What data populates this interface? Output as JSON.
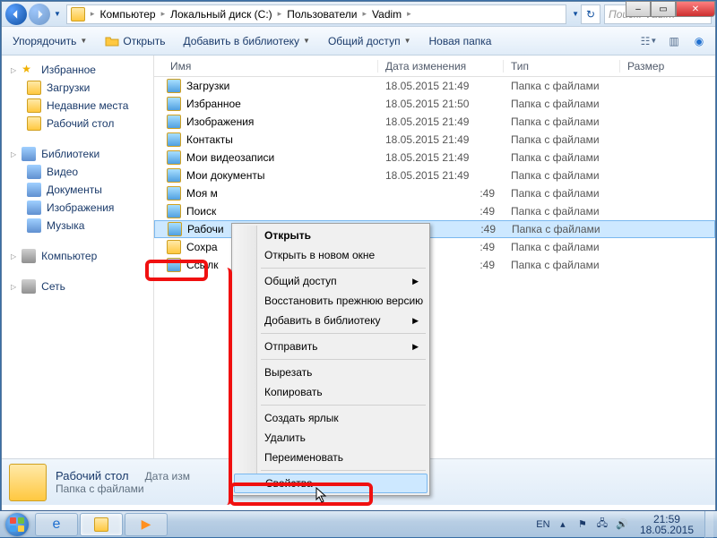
{
  "breadcrumb": {
    "p1": "Компьютер",
    "p2": "Локальный диск (C:)",
    "p3": "Пользователи",
    "p4": "Vadim"
  },
  "search_placeholder": "Поиск: Vadim",
  "toolbar": {
    "organize": "Упорядочить",
    "open": "Открыть",
    "addlib": "Добавить в библиотеку",
    "share": "Общий доступ",
    "newfolder": "Новая папка"
  },
  "columns": {
    "name": "Имя",
    "date": "Дата изменения",
    "type": "Тип",
    "size": "Размер"
  },
  "nav": {
    "favorites": "Избранное",
    "fav": {
      "downloads": "Загрузки",
      "recent": "Недавние места",
      "desktop": "Рабочий стол"
    },
    "libraries": "Библиотеки",
    "lib": {
      "video": "Видео",
      "docs": "Документы",
      "pics": "Изображения",
      "music": "Музыка"
    },
    "computer": "Компьютер",
    "network": "Сеть"
  },
  "typ": "Папка с файлами",
  "rows": {
    "r0": {
      "name": "Загрузки",
      "date": "18.05.2015 21:49"
    },
    "r1": {
      "name": "Избранное",
      "date": "18.05.2015 21:50"
    },
    "r2": {
      "name": "Изображения",
      "date": "18.05.2015 21:49"
    },
    "r3": {
      "name": "Контакты",
      "date": "18.05.2015 21:49"
    },
    "r4": {
      "name": "Мои видеозаписи",
      "date": "18.05.2015 21:49"
    },
    "r5": {
      "name": "Мои документы",
      "date": "18.05.2015 21:49"
    },
    "r6": {
      "name": "Моя м",
      "date": ":49"
    },
    "r7": {
      "name": "Поиск",
      "date": ":49"
    },
    "r8": {
      "name": "Рабочи",
      "date": ":49"
    },
    "r9": {
      "name": "Сохра",
      "date": ":49"
    },
    "r10": {
      "name": "Ссылк",
      "date": ":49"
    }
  },
  "ctx": {
    "open": "Открыть",
    "open_new": "Открыть в новом окне",
    "share": "Общий доступ",
    "restore": "Восстановить прежнюю версию",
    "addlib": "Добавить в библиотеку",
    "send": "Отправить",
    "cut": "Вырезать",
    "copy": "Копировать",
    "shortcut": "Создать ярлык",
    "delete": "Удалить",
    "rename": "Переименовать",
    "props": "Свойства"
  },
  "details": {
    "title": "Рабочий стол",
    "sub": "Папка с файлами",
    "date_lbl": "Дата изм"
  },
  "tray": {
    "lang": "EN",
    "time": "21:59",
    "date": "18.05.2015"
  }
}
